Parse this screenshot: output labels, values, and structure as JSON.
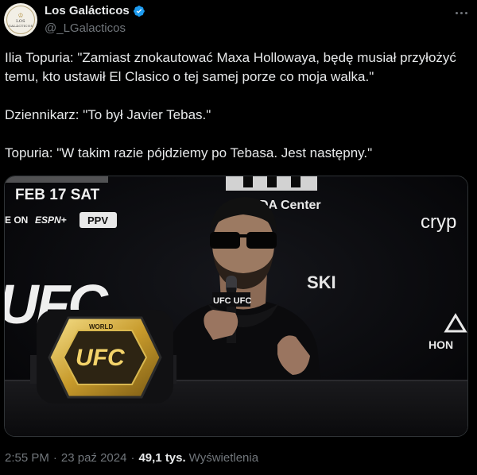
{
  "author": {
    "display_name": "Los Galácticos",
    "handle": "@_LGalacticos",
    "avatar_text_line1": "LOS",
    "avatar_text_line2": "GALÁCTICOS"
  },
  "tweet": {
    "paragraphs": [
      "Ilia Topuria: \"Zamiast znokautować Maxa Hollowaya, będę musiał przyłożyć temu, kto ustawił El Clasico o tej samej porze co moja walka.\"",
      "Dziennikarz: \"To był Javier Tebas.\"",
      "Topuria: \"W takim razie pójdziemy po Tebasa. Jest następny.\""
    ]
  },
  "media": {
    "banner_date": "FEB 17 SAT",
    "banner_live": "E ON",
    "banner_espn": "ESPN+",
    "banner_ppv": "PPV",
    "arena": "DA Center",
    "sponsor_right": "cryp",
    "sponsor_mid": "SKI",
    "ufc_logo": "UFC",
    "mic_label": "UFC UFC",
    "belt_text": "UFC",
    "belt_world": "WORLD",
    "honda": "HON"
  },
  "footer": {
    "time": "2:55 PM",
    "date": "23 paź 2024",
    "views_count": "49,1 tys.",
    "views_label": "Wyświetlenia"
  },
  "colors": {
    "background": "#000000",
    "text": "#e7e9ea",
    "secondary": "#71767b",
    "verified": "#1d9bf0",
    "border": "#2f3336"
  }
}
